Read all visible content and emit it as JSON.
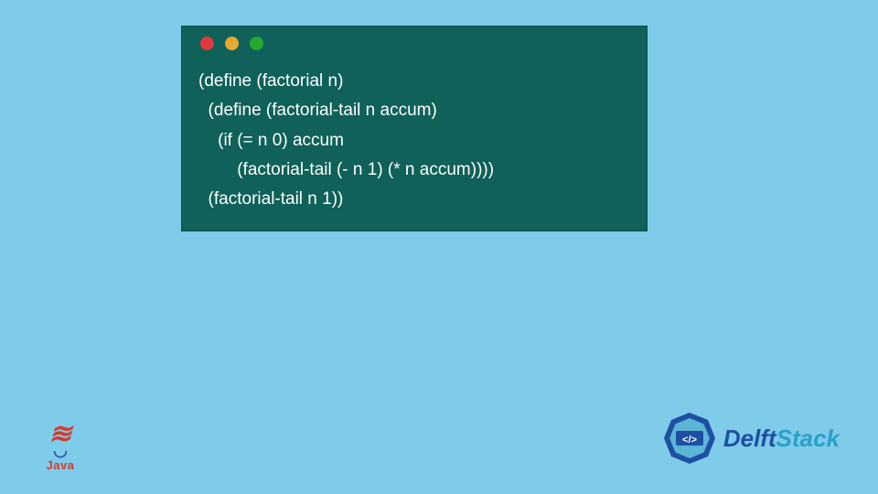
{
  "code": {
    "lines": [
      "(define (factorial n)",
      "  (define (factorial-tail n accum)",
      "    (if (= n 0) accum",
      "        (factorial-tail (- n 1) (* n accum))))",
      "  (factorial-tail n 1))"
    ]
  },
  "logos": {
    "java_label": "Java",
    "delft_prefix": "Delft",
    "delft_suffix": "Stack",
    "delft_code": "</>"
  },
  "colors": {
    "page_bg": "#7ecce9",
    "window_bg": "#0f6159",
    "dot_red": "#e0393e",
    "dot_yellow": "#e7a92e",
    "dot_green": "#28a82e",
    "delft_primary": "#1f4fa3",
    "delft_accent": "#2aa0c9"
  }
}
